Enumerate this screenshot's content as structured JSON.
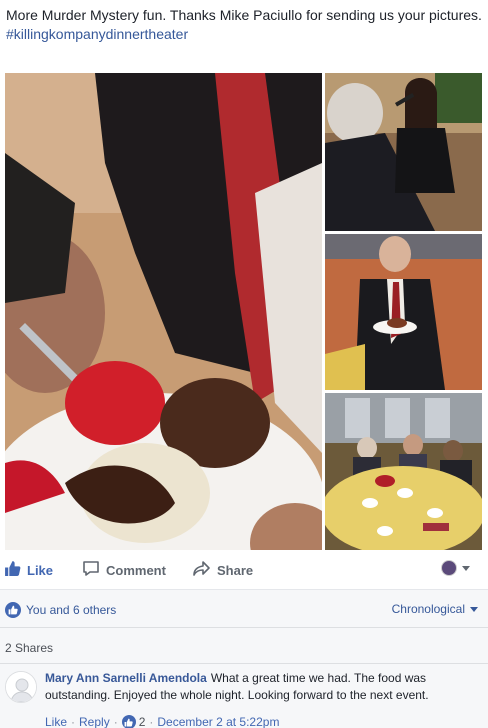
{
  "post": {
    "text": "More Murder Mystery fun. Thanks Mike Paciullo for sending us your pictures.",
    "hashtag": "#killingkompanydinnertheater"
  },
  "photos": [
    {
      "name": "dessert-closeup-photo"
    },
    {
      "name": "singer-performing-photo"
    },
    {
      "name": "man-with-dessert-photo"
    },
    {
      "name": "dinner-table-guests-photo"
    }
  ],
  "actions": {
    "like_label": "Like",
    "comment_label": "Comment",
    "share_label": "Share",
    "like_icon": "thumbs-up-icon",
    "comment_icon": "speech-bubble-icon",
    "share_icon": "share-arrow-icon"
  },
  "feedback": {
    "reactions_text": "You and 6 others",
    "order_label": "Chronological",
    "shares_text": "2 Shares"
  },
  "comment": {
    "author": "Mary Ann Sarnelli Amendola",
    "text": "What a great time we had. The food was outstanding. Enjoyed the whole night. Looking forward to the next event.",
    "like_label": "Like",
    "reply_label": "Reply",
    "like_count": "2",
    "timestamp": "December 2 at 5:22pm"
  },
  "colors": {
    "link": "#365899",
    "brand": "#4267b2",
    "muted": "#90949c",
    "feedback_bg": "#f6f7f9"
  }
}
